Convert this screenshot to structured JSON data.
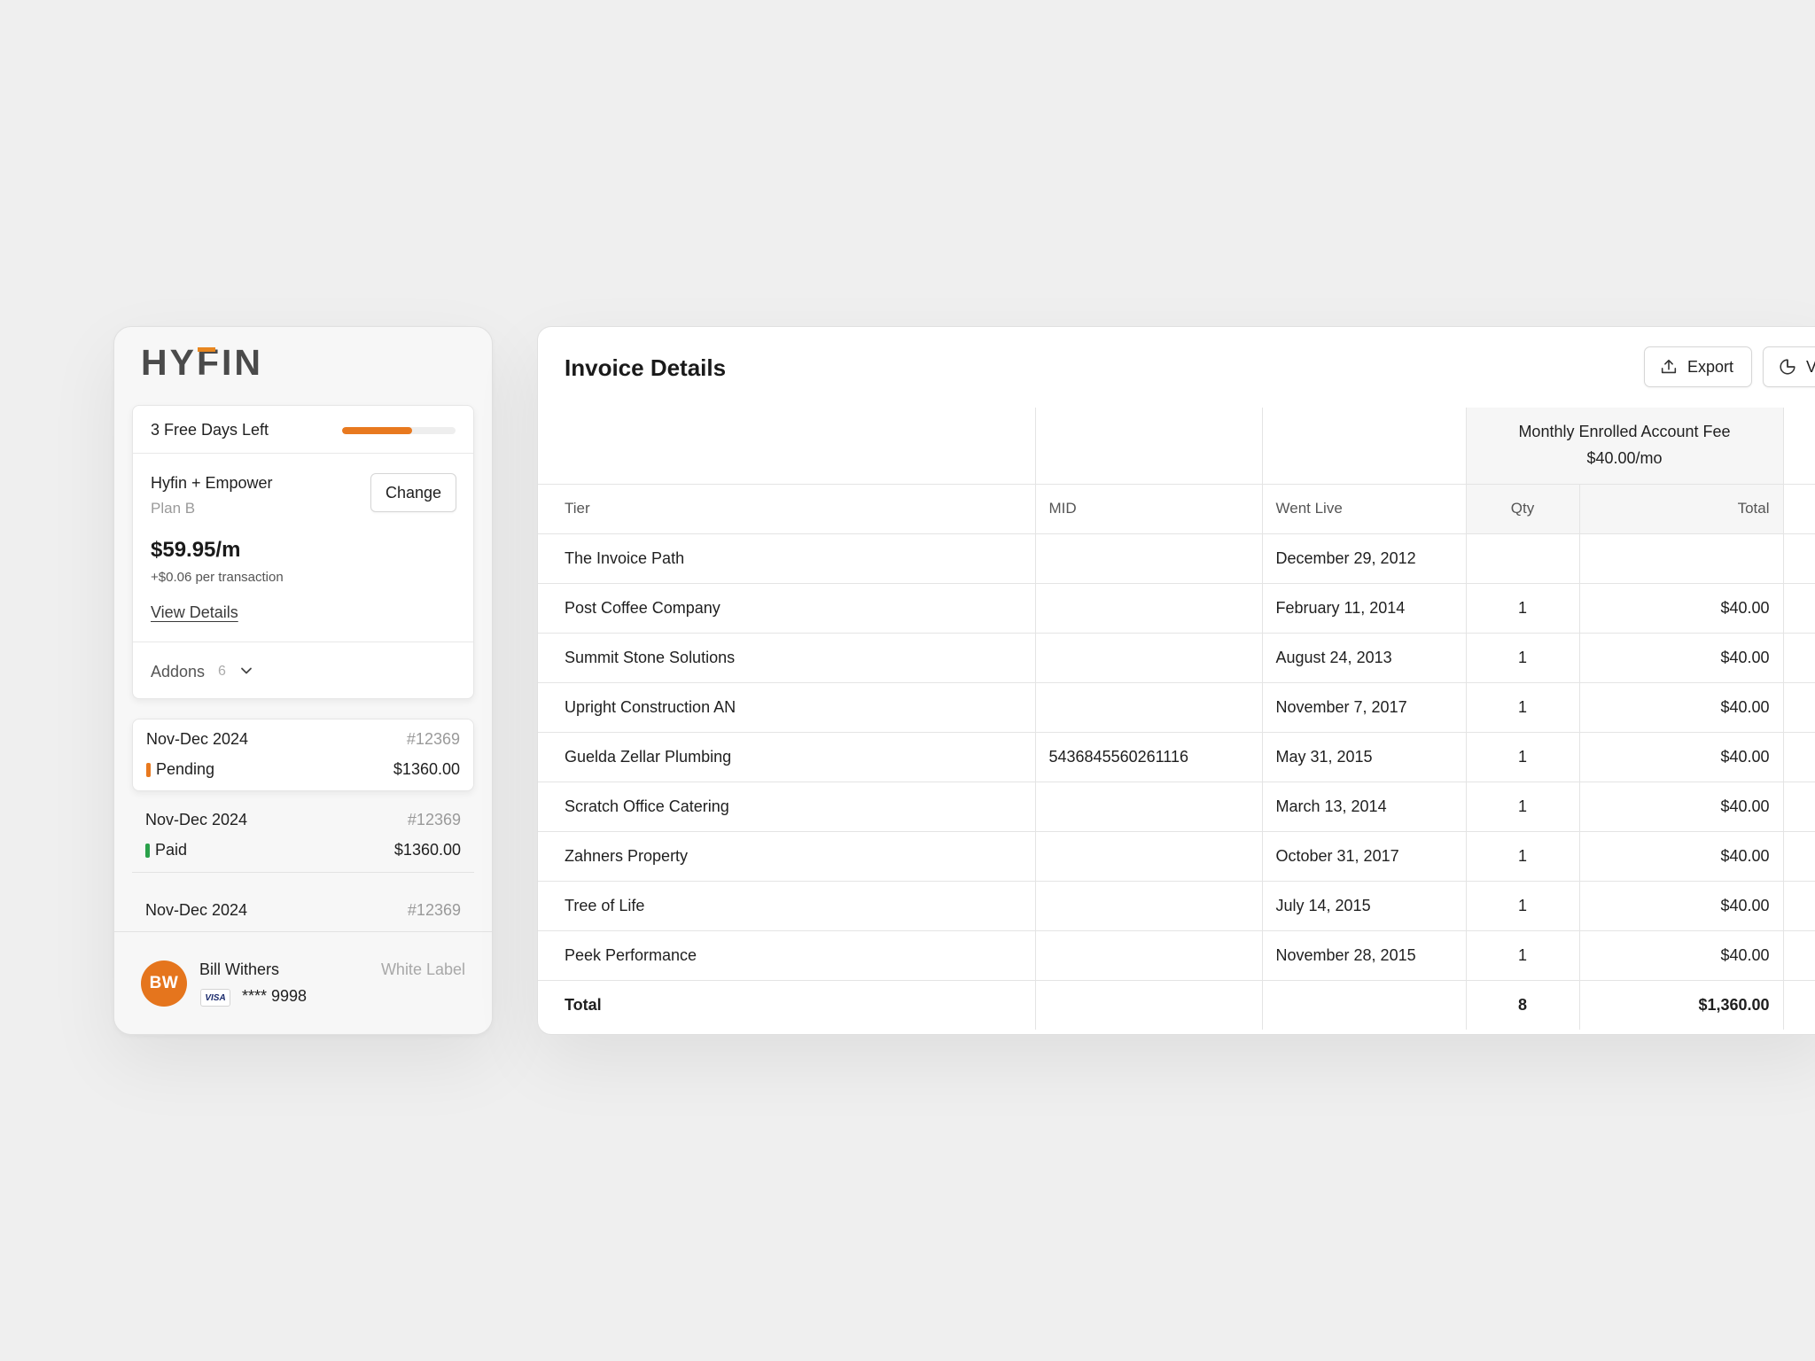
{
  "brand": {
    "logo": "HYFIN",
    "accent": "#e8861f"
  },
  "plan_card": {
    "trial_text": "3 Free Days Left",
    "trial_progress": 0.62,
    "plan_name": "Hyfin + Empower",
    "plan_tier": "Plan B",
    "change_label": "Change",
    "price": "$59.95/m",
    "price_extra": "+$0.06 per transaction",
    "view_details_label": "View Details",
    "addons_label": "Addons",
    "addons_count": "6"
  },
  "invoices": [
    {
      "period": "Nov-Dec 2024",
      "number": "#12369",
      "status": "Pending",
      "status_color": "#e8791f",
      "amount": "$1360.00"
    },
    {
      "period": "Nov-Dec 2024",
      "number": "#12369",
      "status": "Paid",
      "status_color": "#2aa14a",
      "amount": "$1360.00"
    },
    {
      "period": "Nov-Dec 2024",
      "number": "#12369"
    }
  ],
  "account": {
    "initials": "BW",
    "name": "Bill Withers",
    "card_brand": "VISA",
    "card_number": "**** 9998",
    "label": "White Label"
  },
  "invoice_panel": {
    "title": "Invoice Details",
    "export_label": "Export",
    "view_label": "V"
  },
  "table": {
    "group_header": {
      "fee_name": "Monthly Enrolled Account Fee",
      "fee_rate": "$40.00/mo"
    },
    "columns": {
      "tier": "Tier",
      "mid": "MID",
      "went_live": "Went Live",
      "qty": "Qty",
      "total": "Total"
    },
    "rows": [
      {
        "tier": "The Invoice Path",
        "mid": "",
        "went_live": "December 29, 2012",
        "qty": "",
        "total": ""
      },
      {
        "tier": "Post Coffee Company",
        "mid": "",
        "went_live": "February 11, 2014",
        "qty": "1",
        "total": "$40.00"
      },
      {
        "tier": "Summit Stone Solutions",
        "mid": "",
        "went_live": "August 24, 2013",
        "qty": "1",
        "total": "$40.00"
      },
      {
        "tier": "Upright Construction AN",
        "mid": "",
        "went_live": "November 7, 2017",
        "qty": "1",
        "total": "$40.00"
      },
      {
        "tier": "Guelda Zellar Plumbing",
        "mid": "5436845560261116",
        "went_live": "May 31, 2015",
        "qty": "1",
        "total": "$40.00"
      },
      {
        "tier": "Scratch Office Catering",
        "mid": "",
        "went_live": "March 13, 2014",
        "qty": "1",
        "total": "$40.00"
      },
      {
        "tier": "Zahners Property",
        "mid": "",
        "went_live": "October 31, 2017",
        "qty": "1",
        "total": "$40.00"
      },
      {
        "tier": "Tree of Life",
        "mid": "",
        "went_live": "July 14, 2015",
        "qty": "1",
        "total": "$40.00"
      },
      {
        "tier": "Peek Performance",
        "mid": "",
        "went_live": "November 28, 2015",
        "qty": "1",
        "total": "$40.00"
      }
    ],
    "total_row": {
      "label": "Total",
      "qty": "8",
      "total": "$1,360.00"
    }
  }
}
